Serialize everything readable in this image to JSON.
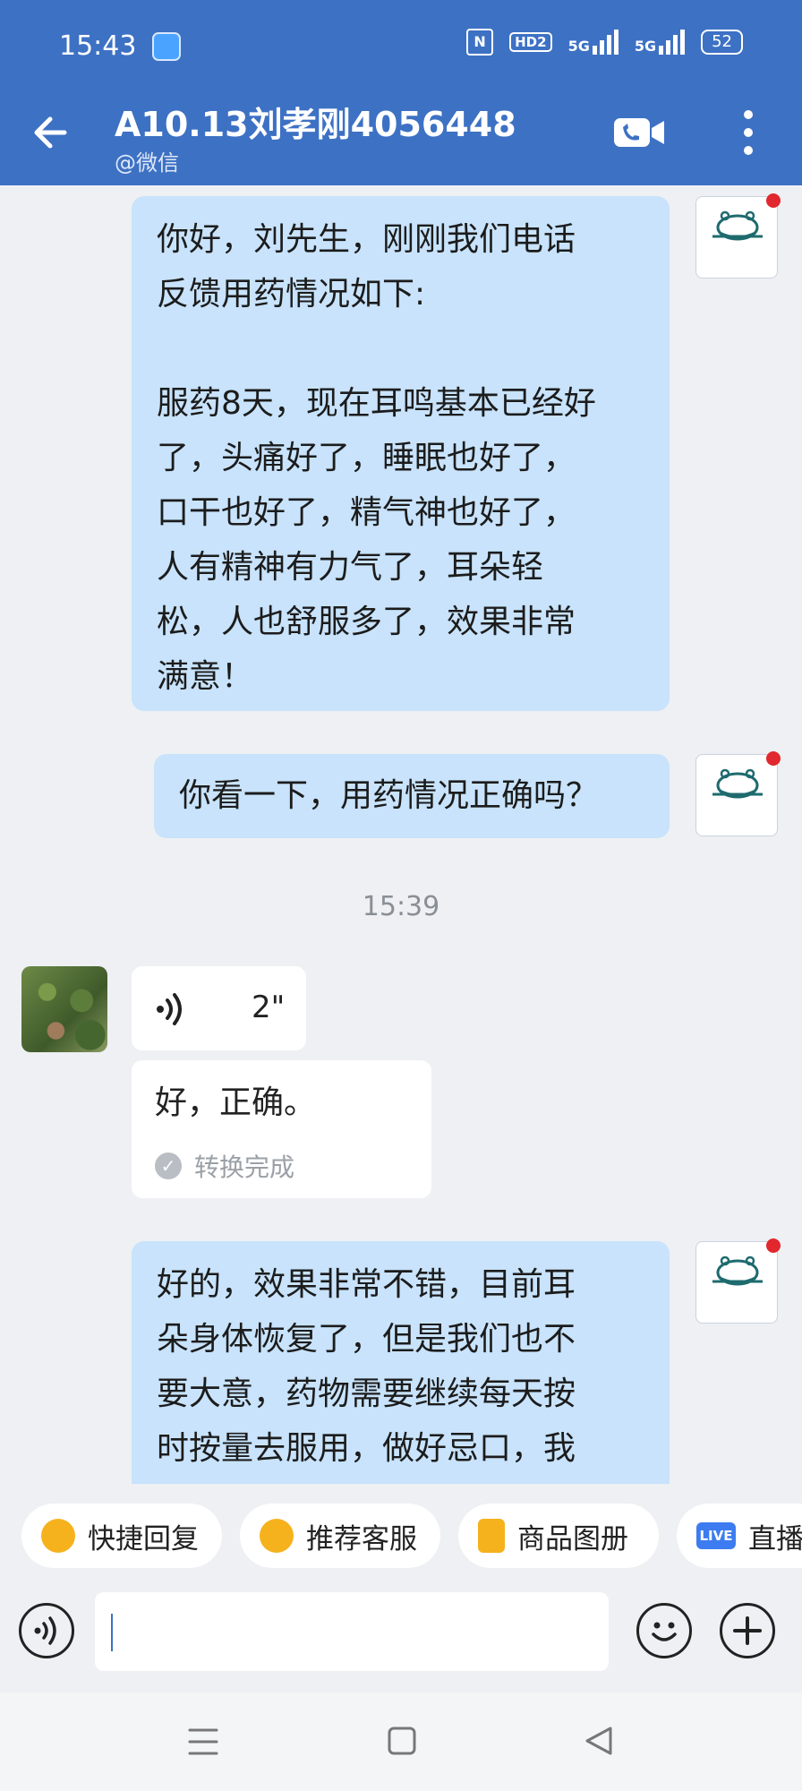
{
  "status_bar": {
    "time": "15:43",
    "nfc": "N",
    "hd": "HD2",
    "sig1": "5G",
    "sig2": "5G",
    "battery": "52"
  },
  "header": {
    "title": "A10.13刘孝刚4056448",
    "subtitle": "@微信",
    "icons": [
      "back-arrow-icon",
      "video-call-icon",
      "more-icon"
    ]
  },
  "messages": {
    "m1_lines": [
      "你好，刘先生，刚刚我们电话",
      "反馈用药情况如下:",
      "",
      "服药8天，现在耳鸣基本已经好",
      "了，头痛好了，睡眠也好了，",
      "口干也好了，精气神也好了，",
      "人有精神有力气了，耳朵轻",
      "松，人也舒服多了，效果非常",
      "满意！"
    ],
    "m2": "你看一下，用药情况正确吗？",
    "timestamp": "15:39",
    "voice_duration": "2\"",
    "transcript": "好，正确。",
    "transcript_status": "转换完成",
    "m3_lines": [
      "好的，效果非常不错，目前耳",
      "朵身体恢复了，但是我们也不",
      "要大意，药物需要继续每天按",
      "时按量去服用，做好忌口，我"
    ]
  },
  "quick_actions": [
    {
      "label": "快捷回复",
      "color": "#f5b21d"
    },
    {
      "label": "推荐客服",
      "color": "#f5b21d"
    },
    {
      "label": "商品图册",
      "color": "#f5b21d"
    },
    {
      "label": "直播",
      "color": "#3d7cf0",
      "badge": "LIVE"
    }
  ],
  "input": {
    "placeholder": ""
  },
  "brand_colors": {
    "header": "#3d71c4",
    "out_bubble": "#c8e3fb"
  }
}
